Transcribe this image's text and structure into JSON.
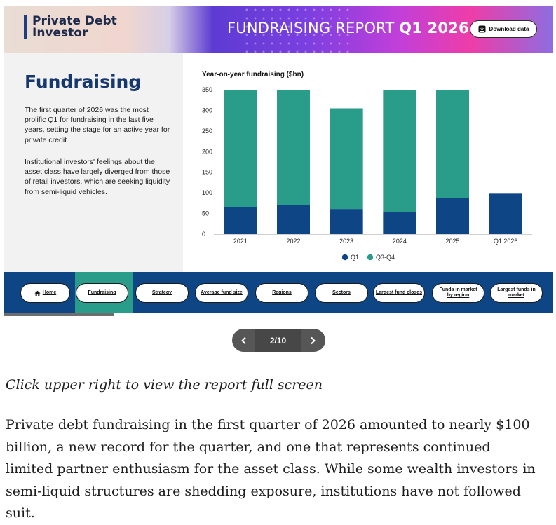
{
  "header": {
    "logo_line1": "Private Debt",
    "logo_line2": "Investor",
    "report_title_light": "FUNDRAISING REPORT",
    "report_title_bold": "Q1 2026",
    "download_label": "Download data",
    "download_icon": "download-icon"
  },
  "section": {
    "title": "Fundraising",
    "para1": "The first quarter of 2026 was the most prolific Q1 for fundraising in the last five years, setting the stage for an active year for private credit.",
    "para2": "Institutional investors' feelings about the asset class have largely diverged from those of retail investors, which are seeking liquidity from semi-liquid vehicles."
  },
  "chart_data": {
    "type": "bar",
    "stacked": true,
    "title": "Year-on-year fundraising ($bn)",
    "categories": [
      "2021",
      "2022",
      "2023",
      "2024",
      "2025",
      "Q1 2026"
    ],
    "series": [
      {
        "name": "Q1",
        "color": "#0d4585",
        "values": [
          66,
          70,
          61,
          53,
          88,
          98
        ]
      },
      {
        "name": "Q3-Q4",
        "color": "#2a9c8a",
        "values": [
          284,
          280,
          244,
          297,
          262,
          0
        ]
      }
    ],
    "ylim": [
      0,
      350
    ],
    "yticks": [
      "0",
      "50",
      "100",
      "150",
      "200",
      "250",
      "300",
      "350"
    ],
    "grid": false,
    "legend": "bottom"
  },
  "nav": {
    "home_icon": "home-icon",
    "items": [
      {
        "label": "Home"
      },
      {
        "label": "Fundraising"
      },
      {
        "label": "Strategy"
      },
      {
        "label": "Average fund size"
      },
      {
        "label": "Regions"
      },
      {
        "label": "Sectors"
      },
      {
        "label": "Largest fund closes"
      },
      {
        "label": "Funds in market by region"
      },
      {
        "label": "Largest funds in market"
      }
    ],
    "active_index": 1
  },
  "progress": {
    "fraction": 0.2
  },
  "pager": {
    "label": "2/10",
    "prev_icon": "chevron-left-icon",
    "next_icon": "chevron-right-icon"
  },
  "caption": "Click upper right to view the report full screen",
  "article": {
    "paragraph": "Private debt fundraising in the first quarter of 2026 amounted to nearly $100 billion, a new record for the quarter, and one that represents continued limited partner enthusiasm for the asset class. While some wealth investors in semi-liquid structures are shedding exposure, institutions have not followed suit."
  }
}
